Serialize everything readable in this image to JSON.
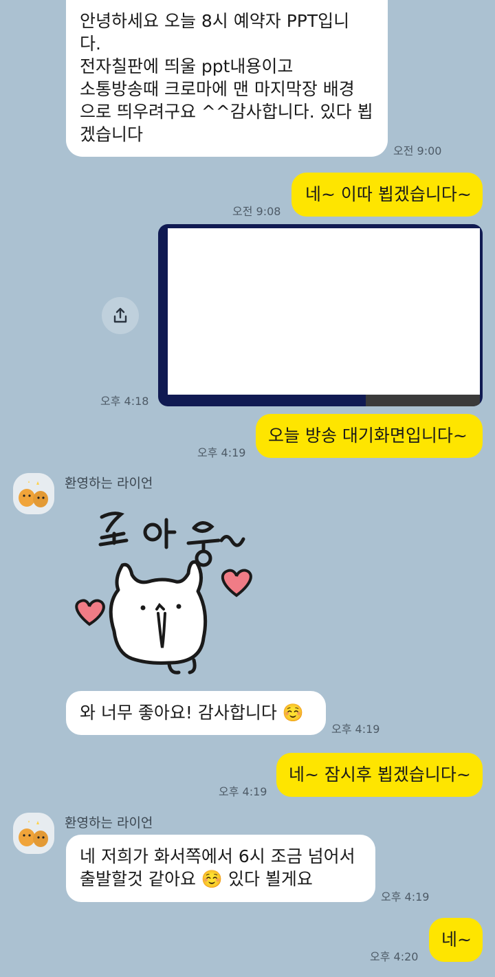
{
  "colors": {
    "background": "#abc1d1",
    "incoming": "#ffffff",
    "outgoing": "#fee500"
  },
  "messages": {
    "m1": {
      "text": "안녕하세요 오늘 8시 예약자 PPT입니\n다.\n전자칠판에 띄울 ppt내용이고\n소통방송때 크로마에 맨 마지막장 배경\n으로 띄우려구요 ^^감사합니다. 있다 뵙\n겠습니다",
      "time": "오전 9:00"
    },
    "m2": {
      "text": "네~ 이따 뵙겠습니다~",
      "time": "오전 9:08"
    },
    "m3": {
      "time": "오후 4:18",
      "share_icon": "share-icon"
    },
    "m4": {
      "text": "오늘 방송 대기화면입니다~",
      "time": "오후 4:19"
    },
    "m5": {
      "sender": "환영하는 라이언",
      "sticker_text": "조아용~",
      "avatar": "ryan-avatar"
    },
    "m6": {
      "text": "와 너무 좋아요! 감사합니다 ☺️",
      "time": "오후 4:19"
    },
    "m7": {
      "text": "네~ 잠시후 뵙겠습니다~",
      "time": "오후 4:19"
    },
    "m8": {
      "sender": "환영하는 라이언",
      "text": "네 저희가 화서쪽에서 6시 조금 넘어서\n출발할것 같아요 ☺️ 있다 뵐게요",
      "time": "오후 4:19"
    },
    "m9": {
      "text": "네~",
      "time": "오후 4:20"
    }
  }
}
